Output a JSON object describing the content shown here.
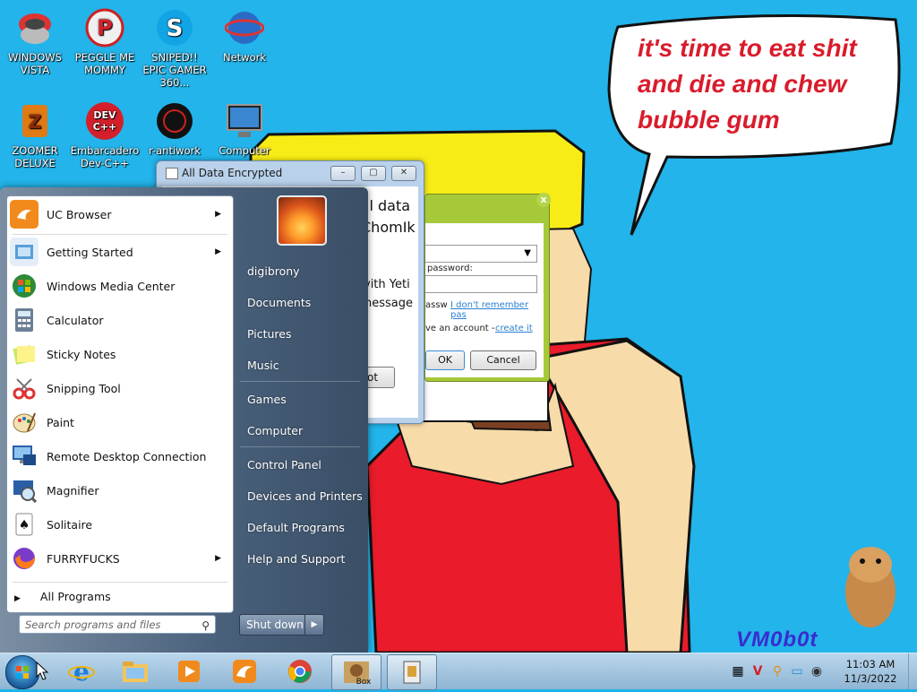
{
  "desktop": {
    "icons": [
      {
        "label": "WINDOWS VISTA"
      },
      {
        "label": "PEGGLE ME MOMMY"
      },
      {
        "label": "SNIPED!! EPIC GAMER 360..."
      },
      {
        "label": "Network"
      },
      {
        "label": "ZOOMER DELUXE"
      },
      {
        "label": "Embarcadero Dev-C++"
      },
      {
        "label": "r-antiwork"
      },
      {
        "label": "Computer"
      }
    ],
    "speech_text": "it's time to eat shit and die and chew bubble gum",
    "watermark": "VM0b0t",
    "icon_badges": {
      "devcpp": "DEV C++",
      "skype": "S",
      "peggle": "P"
    }
  },
  "encrypt_window": {
    "title": "All Data Encrypted",
    "text_line1": "ll data",
    "text_line2": "ChomIk",
    "text_line3": "vith Yeti",
    "text_line4": "nessage",
    "button_label": "ot"
  },
  "login_window": {
    "close_label": "x",
    "password_label": "password:",
    "remember_label": "assw",
    "forgot_link": "I don't remember pas",
    "account_text": "ve an account -",
    "create_link": "create it",
    "ok_label": "OK",
    "cancel_label": "Cancel"
  },
  "start_menu": {
    "programs": [
      {
        "label": "UC Browser",
        "has_arrow": true
      },
      {
        "label": "Getting Started",
        "has_arrow": true
      },
      {
        "label": "Windows Media Center",
        "has_arrow": false
      },
      {
        "label": "Calculator",
        "has_arrow": false
      },
      {
        "label": "Sticky Notes",
        "has_arrow": false
      },
      {
        "label": "Snipping Tool",
        "has_arrow": false
      },
      {
        "label": "Paint",
        "has_arrow": false
      },
      {
        "label": "Remote Desktop Connection",
        "has_arrow": false
      },
      {
        "label": "Magnifier",
        "has_arrow": false
      },
      {
        "label": "Solitaire",
        "has_arrow": false
      },
      {
        "label": "FURRYFUCKS",
        "has_arrow": true
      }
    ],
    "all_programs": "All Programs",
    "search_placeholder": "Search programs and files",
    "right_items": [
      "digibrony",
      "Documents",
      "Pictures",
      "Music",
      "Games",
      "Computer",
      "Control Panel",
      "Devices and Printers",
      "Default Programs",
      "Help and Support"
    ],
    "shutdown_label": "Shut down"
  },
  "taskbar": {
    "pinned": [
      "internet-explorer",
      "file-explorer",
      "media-player",
      "uc-browser",
      "chrome",
      "box",
      "app"
    ],
    "box_label": "Box",
    "clock_time": "11:03 AM",
    "clock_date": "11/3/2022",
    "tray_v": "V"
  }
}
